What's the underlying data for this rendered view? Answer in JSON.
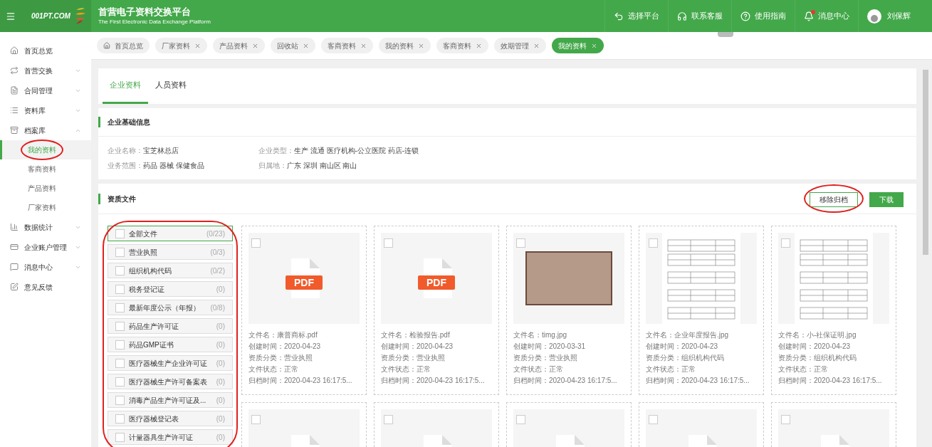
{
  "header": {
    "logo": "001PT.COM",
    "title": "首营电子资料交换平台",
    "subtitle": "The First Electronic Data Exchange Platform",
    "actions": [
      {
        "kind": "switch",
        "label": "选择平台",
        "badge": false
      },
      {
        "kind": "support",
        "label": "联系客服",
        "badge": false
      },
      {
        "kind": "help",
        "label": "使用指南",
        "badge": false
      },
      {
        "kind": "bell",
        "label": "消息中心",
        "badge": true
      }
    ],
    "user": "刘保辉"
  },
  "sidebar": {
    "items": [
      {
        "kind": "home",
        "label": "首页总览"
      },
      {
        "kind": "exchange",
        "label": "首营交换",
        "expanded": false
      },
      {
        "kind": "contract",
        "label": "合同管理",
        "expanded": false
      },
      {
        "kind": "library",
        "label": "资料库",
        "expanded": false
      },
      {
        "kind": "archive",
        "label": "档案库",
        "expanded": true,
        "children": [
          {
            "label": "我的资料",
            "selected": true,
            "circled": true
          },
          {
            "label": "客商资料",
            "selected": false,
            "circled": false
          },
          {
            "label": "产品资料",
            "selected": false,
            "circled": false
          },
          {
            "label": "厂家资料",
            "selected": false,
            "circled": false
          }
        ]
      },
      {
        "kind": "stats",
        "label": "数据统计",
        "expanded": false
      },
      {
        "kind": "account",
        "label": "企业账户管理",
        "expanded": false
      },
      {
        "kind": "message",
        "label": "消息中心",
        "expanded": false
      },
      {
        "kind": "feedback",
        "label": "意见反馈"
      }
    ]
  },
  "open_tabs": [
    {
      "label": "首页总览",
      "kind": "home",
      "selected": false
    },
    {
      "label": "厂家资料",
      "kind": "page",
      "selected": false
    },
    {
      "label": "产品资料",
      "kind": "page",
      "selected": false
    },
    {
      "label": "回收站",
      "kind": "page",
      "selected": false
    },
    {
      "label": "客商资料",
      "kind": "page",
      "selected": false
    },
    {
      "label": "我的资料",
      "kind": "page",
      "selected": false
    },
    {
      "label": "客商资料",
      "kind": "page",
      "selected": false
    },
    {
      "label": "效期管理",
      "kind": "page",
      "selected": false
    },
    {
      "label": "我的资料",
      "kind": "page",
      "selected": true
    }
  ],
  "page_tabs": [
    {
      "label": "企业资料",
      "selected": true
    },
    {
      "label": "人员资料",
      "selected": false
    }
  ],
  "basic_info": {
    "title": "企业基础信息",
    "fields": [
      {
        "label": "企业名称：",
        "value": "宝芝林总店"
      },
      {
        "label": "企业类型：",
        "value": "生产 流通 医疗机构-公立医院 药店-连锁"
      },
      {
        "label": "业务范围：",
        "value": "药品 器械 保健食品"
      },
      {
        "label": "归属地：",
        "value": "广东 深圳 南山区 南山"
      }
    ]
  },
  "documents": {
    "title": "资质文件",
    "buttons": [
      {
        "kind": "outline",
        "label": "移除归档",
        "circled": true
      },
      {
        "kind": "primary",
        "label": "下载",
        "circled": false
      }
    ],
    "categories_circled": true,
    "categories": [
      {
        "label": "全部文件",
        "count": "(0/23)",
        "selected": true,
        "checked": false
      },
      {
        "label": "营业执照",
        "count": "(0/3)",
        "selected": false,
        "checked": false
      },
      {
        "label": "组织机构代码",
        "count": "(0/2)",
        "selected": false,
        "checked": false
      },
      {
        "label": "税务登记证",
        "count": "(0)",
        "selected": false,
        "checked": false
      },
      {
        "label": "最新年度公示（年报）",
        "count": "(0/8)",
        "selected": false,
        "checked": false
      },
      {
        "label": "药品生产许可证",
        "count": "(0)",
        "selected": false,
        "checked": false
      },
      {
        "label": "药品GMP证书",
        "count": "(0)",
        "selected": false,
        "checked": false
      },
      {
        "label": "医疗器械生产企业许可证",
        "count": "(0)",
        "selected": false,
        "checked": false
      },
      {
        "label": "医疗器械生产许可备案表",
        "count": "(0)",
        "selected": false,
        "checked": false
      },
      {
        "label": "消毒产品生产许可证及...",
        "count": "(0)",
        "selected": false,
        "checked": false
      },
      {
        "label": "医疗器械登记表",
        "count": "(0)",
        "selected": false,
        "checked": false
      },
      {
        "label": "计量器具生产许可证",
        "count": "(0)",
        "selected": false,
        "checked": false
      }
    ],
    "files": [
      {
        "kind": "pdf",
        "icon_text": "PDF",
        "checked": false,
        "lines": [
          "文件名：康普商标.pdf",
          "创建时间：2020-04-23",
          "资质分类：营业执照",
          "文件状态：正常",
          "归档时间：2020-04-23 16:17:5..."
        ]
      },
      {
        "kind": "pdf",
        "icon_text": "PDF",
        "checked": false,
        "lines": [
          "文件名：检验报告.pdf",
          "创建时间：2020-04-23",
          "资质分类：营业执照",
          "文件状态：正常",
          "归档时间：2020-04-23 16:17:5..."
        ]
      },
      {
        "kind": "photo",
        "checked": false,
        "lines": [
          "文件名：timg.jpg",
          "创建时间：2020-03-31",
          "资质分类：营业执照",
          "文件状态：正常",
          "归档时间：2020-04-23 16:17:5..."
        ]
      },
      {
        "kind": "document",
        "checked": false,
        "lines": [
          "文件名：企业年度报告.jpg",
          "创建时间：2020-04-23",
          "资质分类：组织机构代码",
          "文件状态：正常",
          "归档时间：2020-04-23 16:17:5..."
        ]
      },
      {
        "kind": "document",
        "checked": false,
        "lines": [
          "文件名：小-社保证明.jpg",
          "创建时间：2020-04-23",
          "资质分类：组织机构代码",
          "文件状态：正常",
          "归档时间：2020-04-23 16:17:5..."
        ]
      },
      {
        "kind": "pdf",
        "checked": false
      },
      {
        "kind": "pdf",
        "checked": false
      },
      {
        "kind": "pdf",
        "checked": false
      },
      {
        "kind": "pdf",
        "checked": false
      },
      {
        "kind": "pdf",
        "checked": false
      }
    ]
  }
}
